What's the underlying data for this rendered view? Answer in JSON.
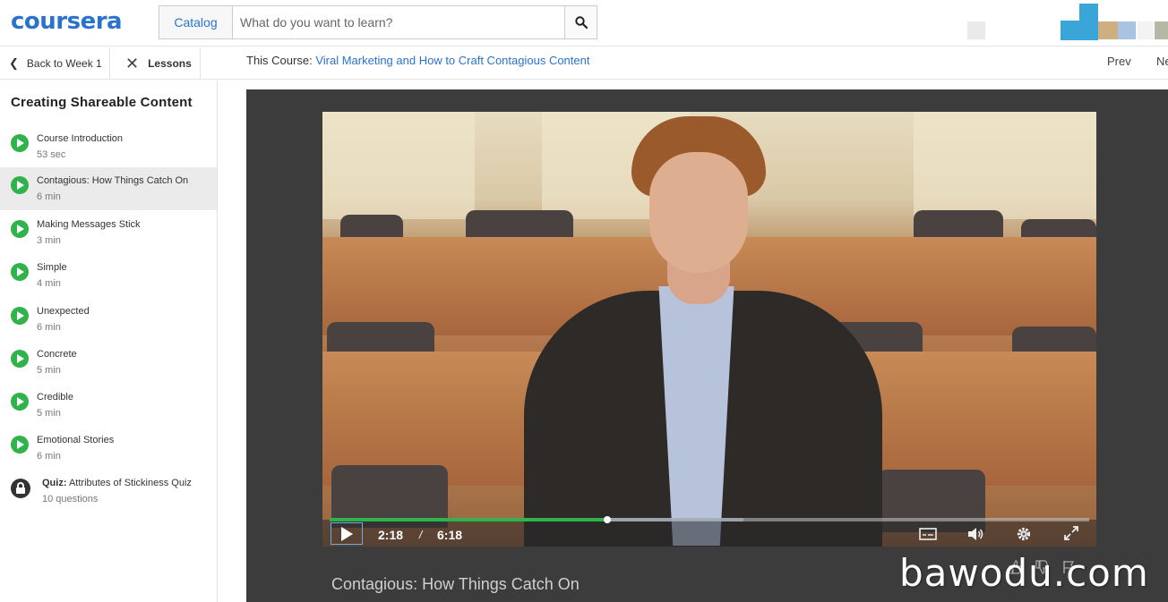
{
  "header": {
    "logo_text": "coursera",
    "catalog_label": "Catalog",
    "search_placeholder": "What do you want to learn?"
  },
  "subbar": {
    "back_label": "Back to Week 1",
    "lessons_label": "Lessons",
    "course_prefix": "This Course:",
    "course_name": "Viral Marketing and How to Craft Contagious Content",
    "prev_label": "Prev",
    "next_label": "Ne"
  },
  "sidebar": {
    "title": "Creating Shareable Content",
    "items": [
      {
        "label": "Course Introduction",
        "meta": "53 sec",
        "type": "video"
      },
      {
        "label": "Contagious: How Things Catch On",
        "meta": "6 min",
        "type": "video",
        "active": true
      },
      {
        "label": "Making Messages Stick",
        "meta": "3 min",
        "type": "video"
      },
      {
        "label": "Simple",
        "meta": "4 min",
        "type": "video"
      },
      {
        "label": "Unexpected",
        "meta": "6 min",
        "type": "video"
      },
      {
        "label": "Concrete",
        "meta": "5 min",
        "type": "video"
      },
      {
        "label": "Credible",
        "meta": "5 min",
        "type": "video"
      },
      {
        "label": "Emotional Stories",
        "meta": "6 min",
        "type": "video"
      },
      {
        "label": "Attributes of Stickiness Quiz",
        "prefix": "Quiz:",
        "meta": "10 questions",
        "type": "quiz"
      }
    ]
  },
  "player": {
    "current_time": "2:18",
    "separator": "/",
    "duration": "6:18",
    "progress_fraction": 0.365,
    "buffered_fraction": 0.545
  },
  "main": {
    "video_title": "Contagious: How Things Catch On"
  },
  "watermark": "bawodu.com",
  "colors": {
    "brand": "#2a73cc",
    "play_green": "#2fb34a",
    "player_bg": "#3c3c3c"
  },
  "icons": [
    "search-icon",
    "chevron-left-icon",
    "close-icon",
    "play-circle-icon",
    "lock-icon",
    "play-icon",
    "captions-icon",
    "volume-icon",
    "gear-icon",
    "fullscreen-icon",
    "thumbs-up-icon",
    "thumbs-down-icon",
    "flag-icon"
  ]
}
